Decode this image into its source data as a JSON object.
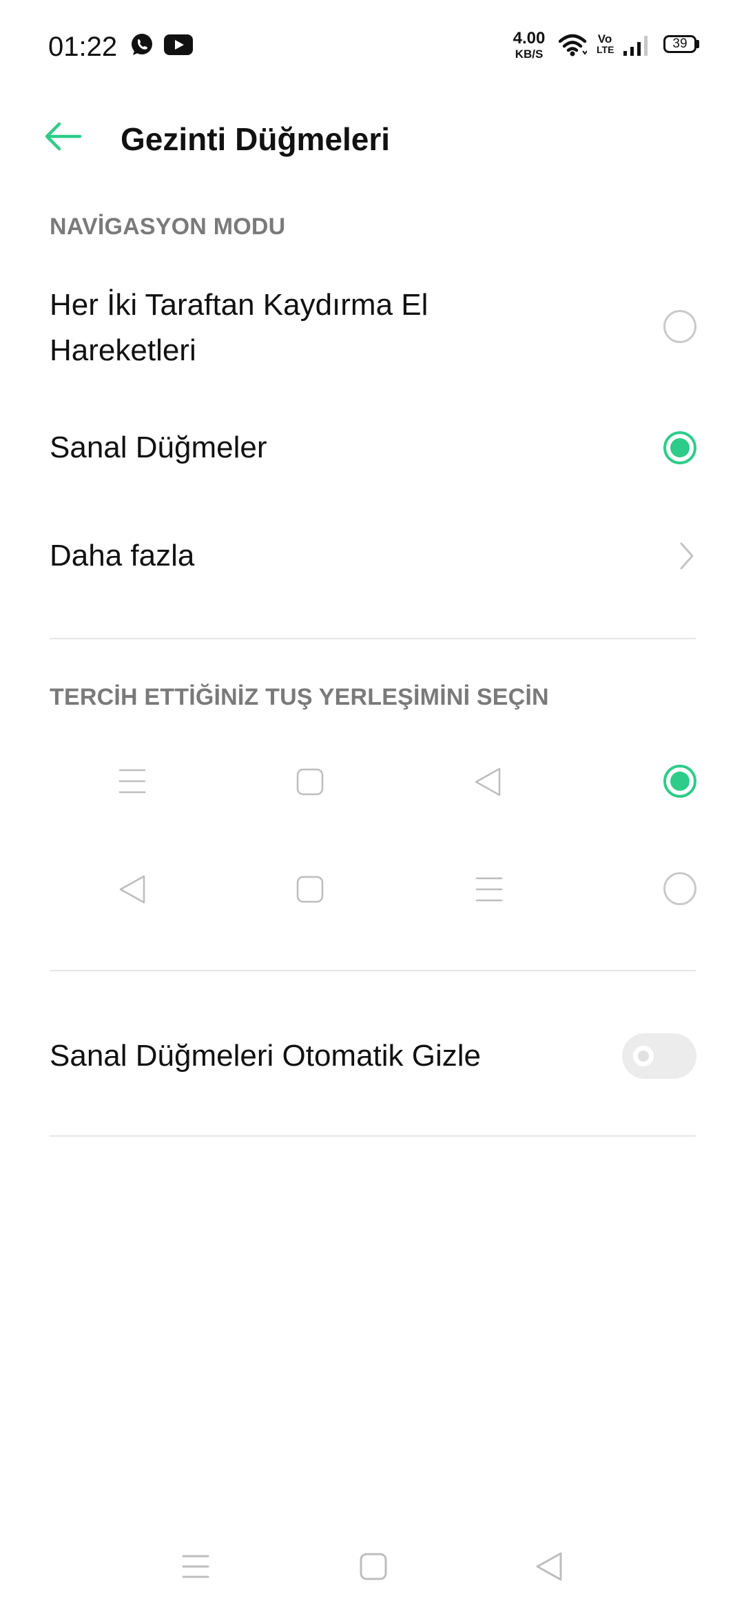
{
  "status_bar": {
    "time": "01:22",
    "notification_icons": [
      "whatsapp-icon",
      "youtube-icon"
    ],
    "net_speed_value": "4.00",
    "net_speed_unit": "KB/S",
    "volte_top": "Vo",
    "volte_bottom": "LTE",
    "battery_level": "39"
  },
  "header": {
    "title": "Gezinti Düğmeleri",
    "back_icon": "back-arrow-icon"
  },
  "navigation_mode": {
    "section_label": "NAVİGASYON MODU",
    "options": [
      {
        "label_line1": "Her İki Taraftan Kaydırma El",
        "label_line2": "Hareketleri",
        "selected": false
      },
      {
        "label": "Sanal Düğmeler",
        "selected": true
      }
    ],
    "more_label": "Daha fazla"
  },
  "key_layout": {
    "section_label": "TERCİH ETTİĞİNİZ TUŞ YERLEŞİMİNİ SEÇİN",
    "layouts": [
      {
        "icons": [
          "menu-icon",
          "home-square-icon",
          "back-triangle-icon"
        ],
        "selected": true
      },
      {
        "icons": [
          "back-triangle-icon",
          "home-square-icon",
          "menu-icon"
        ],
        "selected": false
      }
    ]
  },
  "auto_hide": {
    "label": "Sanal Düğmeleri Otomatik Gizle",
    "enabled": false
  },
  "system_nav": {
    "icons": [
      "menu-icon",
      "home-square-icon",
      "back-triangle-icon"
    ]
  },
  "colors": {
    "accent": "#2ecc8a",
    "section_label": "#7a7a7a",
    "icon_gray": "#bdbdbd"
  }
}
